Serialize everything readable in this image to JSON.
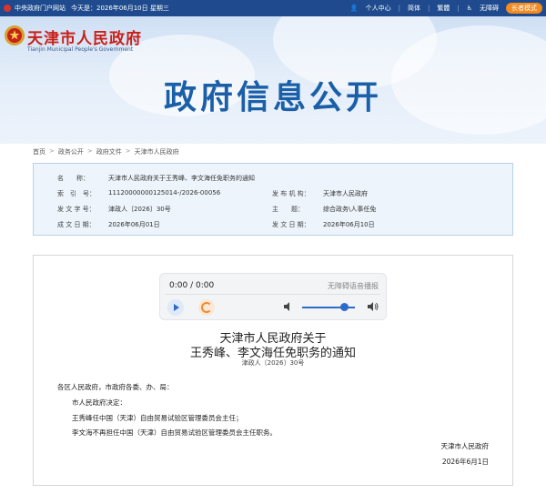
{
  "topbar": {
    "central_portal": "中央政府门户网站",
    "today": "今天是：2026年06月10日 星期三",
    "user_center": "个人中心",
    "simplified": "简体",
    "traditional": "繁體",
    "accessibility": "无障碍",
    "care_mode": "长者模式"
  },
  "header": {
    "site_name": "天津市人民政府",
    "site_name_en": "Tianjin Municipal People's Government",
    "banner_title": "政府信息公开"
  },
  "breadcrumb": [
    "首页",
    "政务公开",
    "政府文件",
    "天津市人民政府"
  ],
  "meta": {
    "name_label": "名　　称：",
    "name_value": "天津市人民政府关于王秀峰、李文海任免职务的通知",
    "index_label": "索　引　号：",
    "index_value": "11120000000125014-/2026-00056",
    "org_label": "发 布 机 构：",
    "org_value": "天津市人民政府",
    "docno_label": "发 文 字 号：",
    "docno_value": "津政人〔2026〕30号",
    "topic_label": "主　　题：",
    "topic_value": "综合政务\\人事任免",
    "created_label": "成 文 日 期：",
    "created_value": "2026年06月01日",
    "published_label": "发 文 日 期：",
    "published_value": "2026年06月10日"
  },
  "player": {
    "time": "0:00 / 0:00",
    "a11y_label": "无障碍语音播报",
    "volume": 0.8
  },
  "document": {
    "title_line1": "天津市人民政府关于",
    "title_line2": "王秀峰、李文海任免职务的通知",
    "doc_number": "津政人〔2026〕30号",
    "addressee": "各区人民政府，市政府各委、办、局：",
    "para1": "市人民政府决定：",
    "para2": "王秀峰任中国（天津）自由贸易试验区管理委员会主任；",
    "para3": "李文海不再担任中国（天津）自由贸易试验区管理委员会主任职务。",
    "signature": "天津市人民政府",
    "date": "2026年6月1日"
  }
}
